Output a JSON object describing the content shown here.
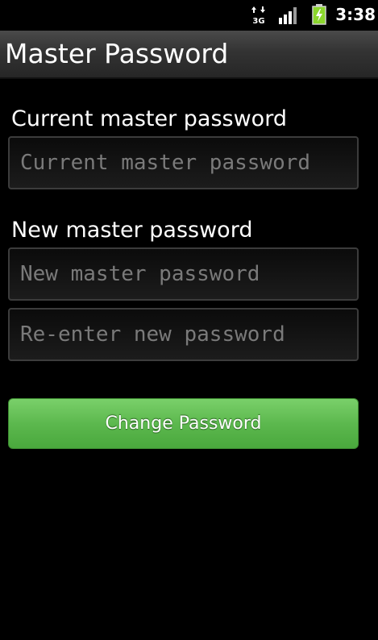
{
  "status_bar": {
    "network_type": "3G",
    "time": "3:38",
    "battery_icon": "battery-charging-icon",
    "signal_icon": "signal-bars-icon",
    "network_icon": "network-3g-icon"
  },
  "title_bar": {
    "title": "Master Password"
  },
  "form": {
    "current_label": "Current master password",
    "current_placeholder": "Current master password",
    "current_value": "",
    "new_label": "New master password",
    "new_placeholder": "New master password",
    "new_value": "",
    "reenter_placeholder": "Re-enter new password",
    "reenter_value": "",
    "submit_label": "Change Password"
  },
  "colors": {
    "background": "#000000",
    "button_green": "#5cb84e",
    "placeholder_gray": "#7a7a7a",
    "battery_green": "#8bd62c"
  }
}
